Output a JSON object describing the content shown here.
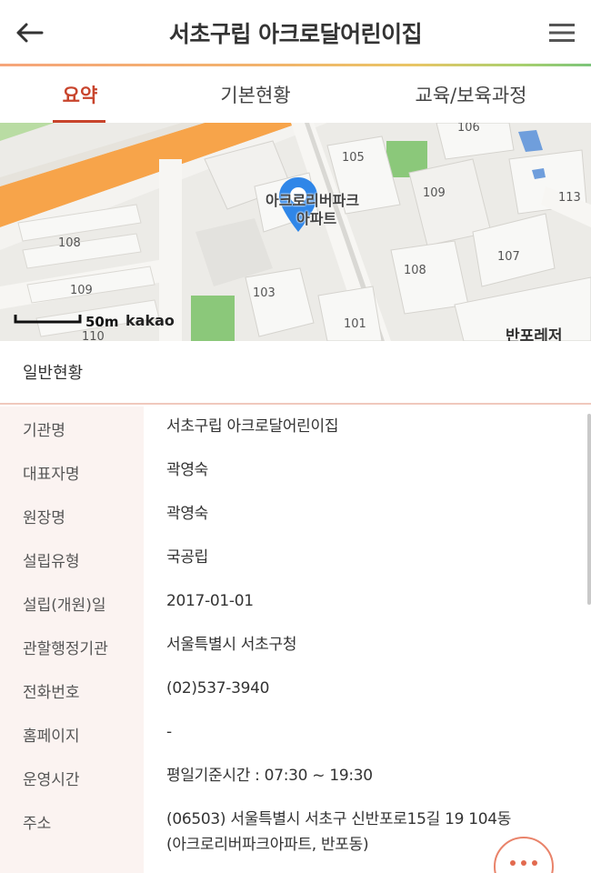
{
  "header": {
    "title": "서초구립 아크로달어린이집"
  },
  "tabs": [
    {
      "label": "요약",
      "active": true
    },
    {
      "label": "기본현황",
      "active": false
    },
    {
      "label": "교육/보육과정",
      "active": false
    }
  ],
  "map": {
    "poi_name_line1": "아크로리버파크",
    "poi_name_line2": "아파트",
    "building_labels": [
      "106",
      "105",
      "109",
      "113",
      "108",
      "107",
      "108",
      "109",
      "103",
      "101",
      "110"
    ],
    "scale": "50m",
    "provider": "kakao",
    "place_label": "반포레저"
  },
  "section": {
    "title": "일반현황"
  },
  "info_rows": [
    {
      "label": "기관명",
      "value": "서초구립 아크로달어린이집"
    },
    {
      "label": "대표자명",
      "value": "곽영숙"
    },
    {
      "label": "원장명",
      "value": "곽영숙"
    },
    {
      "label": "설립유형",
      "value": "국공립"
    },
    {
      "label": "설립(개원)일",
      "value": "2017-01-01"
    },
    {
      "label": "관할행정기관",
      "value": "서울특별시 서초구청"
    },
    {
      "label": "전화번호",
      "value": "(02)537-3940"
    },
    {
      "label": "홈페이지",
      "value": "-"
    },
    {
      "label": "운영시간",
      "value": "평일기준시간 : 07:30 ~ 19:30"
    },
    {
      "label": "주소",
      "value": "(06503) 서울특별시 서초구 신반포로15길 19 104동",
      "value_line2": "(아크로리버파크아파트, 반포동)"
    }
  ],
  "colors": {
    "accent": "#c8442c",
    "header_gradient_start": "#f6a57a",
    "header_gradient_end": "#7cc47a",
    "label_bg": "#fbf3f1",
    "map_marker": "#2f86e8",
    "road_orange": "#f7a44a"
  },
  "icons": {
    "back": "arrow-left-icon",
    "menu": "hamburger-menu-icon",
    "marker": "map-pin-icon",
    "more": "more-dots-icon"
  }
}
